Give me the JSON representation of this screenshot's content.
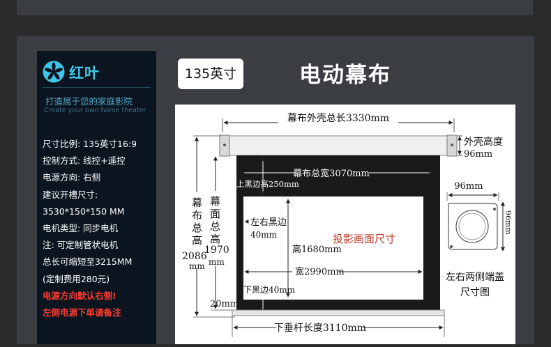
{
  "brand": {
    "name": "红叶",
    "slogan_cn": "打造属于您的家庭影院",
    "slogan_en": "Create your own home theater"
  },
  "specs": [
    {
      "text": "尺寸比例:  135英寸16:9",
      "highlight": false
    },
    {
      "text": "控制方式:  线控+遥控",
      "highlight": false
    },
    {
      "text": "电源方向:  右侧",
      "highlight": false
    },
    {
      "text": "建议开槽尺寸:",
      "highlight": false
    },
    {
      "text": "3530*150*150 MM",
      "highlight": false
    },
    {
      "text": "电机类型:  同步电机",
      "highlight": false
    },
    {
      "text": "注:  可定制管状电机",
      "highlight": false
    },
    {
      "text": "总长可缩短至3215MM",
      "highlight": false
    },
    {
      "text": "(定制费用280元)",
      "highlight": false
    },
    {
      "text": "电源方向默认右侧!",
      "highlight": true
    },
    {
      "text": "左侧电源下单请备注",
      "highlight": true
    }
  ],
  "size_badge": "135英寸",
  "title": "电动幕布",
  "diagram": {
    "housing_length": "幕布外壳总长3330mm",
    "housing_height_label": "外壳高度",
    "housing_height_value": "96mm",
    "screen_total_width": "幕布总宽3070mm",
    "top_border": "上黑边高250mm",
    "left_right_border_label": "左右黑边",
    "left_right_border_value": "40mm",
    "image_height": "高1680mm",
    "image_width": "宽2990mm",
    "bottom_border": "下黑边40mm",
    "projection_label": "投影画面尺寸",
    "total_height_chars": [
      "幕",
      "布",
      "总",
      "高"
    ],
    "total_height_value": "2086",
    "total_height_unit": "mm",
    "screen_height_chars": [
      "幕",
      "面",
      "总",
      "高"
    ],
    "screen_height_value": "1970",
    "screen_height_unit": "mm",
    "bottom_gap": "20mm",
    "bottom_bar_length": "下垂杆长度3110mm",
    "endcap_width": "96mm",
    "endcap_height": "96mm",
    "endcap_caption_1": "左右两侧端盖",
    "endcap_caption_2": "尺寸图",
    "projection_color": "#c0392b"
  }
}
